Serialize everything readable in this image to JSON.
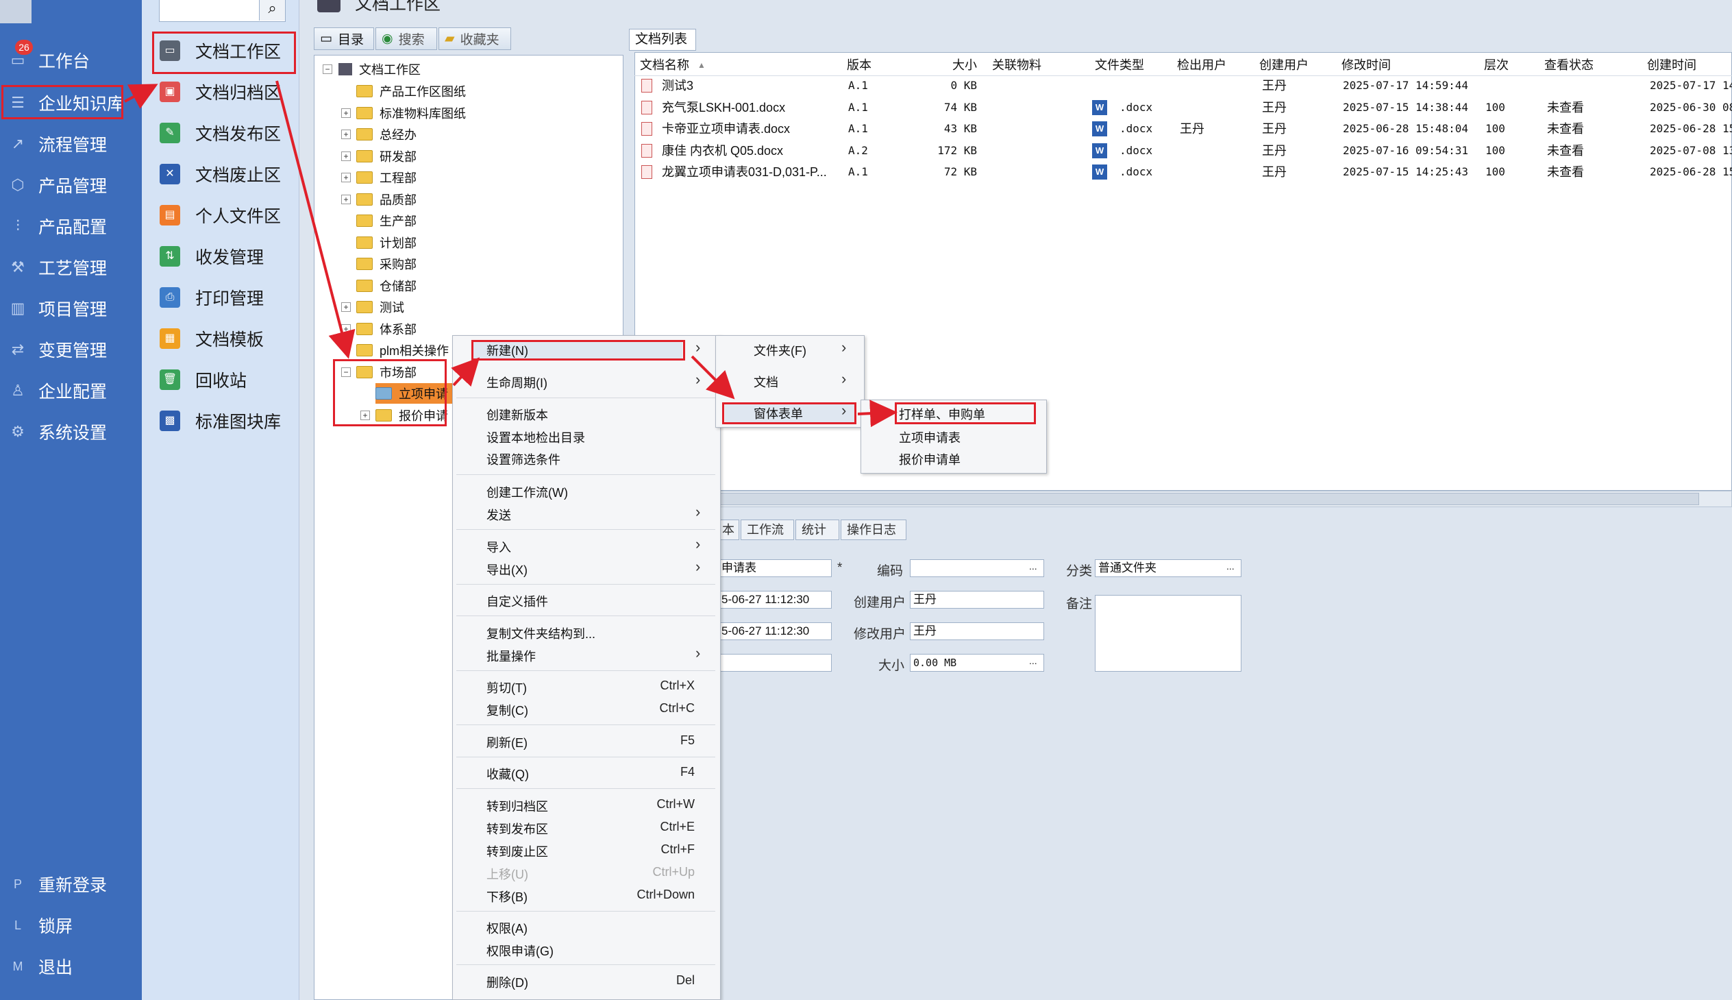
{
  "sidebar": {
    "badge": "26",
    "items": [
      {
        "label": "工作台",
        "icon": "monitor-icon"
      },
      {
        "label": "企业知识库",
        "icon": "library-icon"
      },
      {
        "label": "流程管理",
        "icon": "flow-icon"
      },
      {
        "label": "产品管理",
        "icon": "cube-icon"
      },
      {
        "label": "产品配置",
        "icon": "sliders-icon"
      },
      {
        "label": "工艺管理",
        "icon": "wrench-icon"
      },
      {
        "label": "项目管理",
        "icon": "chart-icon"
      },
      {
        "label": "变更管理",
        "icon": "swap-icon"
      },
      {
        "label": "企业配置",
        "icon": "users-icon"
      },
      {
        "label": "系统设置",
        "icon": "gear-icon"
      }
    ],
    "bottom": [
      {
        "key": "P",
        "label": "重新登录"
      },
      {
        "key": "L",
        "label": "锁屏"
      },
      {
        "key": "M",
        "label": "退出"
      }
    ]
  },
  "submenu": {
    "items": [
      {
        "label": "文档工作区",
        "color": "#5a6472"
      },
      {
        "label": "文档归档区",
        "color": "#e05050"
      },
      {
        "label": "文档发布区",
        "color": "#3aa35a"
      },
      {
        "label": "文档废止区",
        "color": "#2f5fb0"
      },
      {
        "label": "个人文件区",
        "color": "#f07a2a"
      },
      {
        "label": "收发管理",
        "color": "#3aa35a"
      },
      {
        "label": "打印管理",
        "color": "#3d7cc9"
      },
      {
        "label": "文档模板",
        "color": "#f0a020"
      },
      {
        "label": "回收站",
        "color": "#3aa35a"
      },
      {
        "label": "标准图块库",
        "color": "#2f5fb0"
      }
    ]
  },
  "main": {
    "title": "文档工作区",
    "left_tabs": [
      "目录",
      "搜索",
      "收藏夹"
    ],
    "tree": {
      "root": "文档工作区",
      "nodes": [
        "产品工作区图纸",
        "标准物料库图纸",
        "总经办",
        "研发部",
        "工程部",
        "品质部",
        "生产部",
        "计划部",
        "采购部",
        "仓储部",
        "测试",
        "体系部",
        "plm相关操作",
        "市场部"
      ],
      "children": [
        "立项申请",
        "报价申请"
      ]
    },
    "doclist": {
      "tab": "文档列表",
      "columns": [
        "文档名称",
        "版本",
        "大小",
        "关联物料",
        "文件类型",
        "检出用户",
        "创建用户",
        "修改时间",
        "层次",
        "查看状态",
        "创建时间"
      ],
      "rows": [
        {
          "name": "测试3",
          "ver": "A.1",
          "size": "0 KB",
          "material": "",
          "type": "",
          "checkout": "",
          "creator": "王丹",
          "mtime": "2025-07-17 14:59:44",
          "level": "",
          "status": "",
          "ctime": "2025-07-17 14"
        },
        {
          "name": "充气泵LSKH-001.docx",
          "ver": "A.1",
          "size": "74 KB",
          "material": "",
          "type": ".docx",
          "checkout": "",
          "creator": "王丹",
          "mtime": "2025-07-15 14:38:44",
          "level": "100",
          "status": "未查看",
          "ctime": "2025-06-30 08"
        },
        {
          "name": "卡帝亚立项申请表.docx",
          "ver": "A.1",
          "size": "43 KB",
          "material": "",
          "type": ".docx",
          "checkout": "王丹",
          "creator": "王丹",
          "mtime": "2025-06-28 15:48:04",
          "level": "100",
          "status": "未查看",
          "ctime": "2025-06-28 15"
        },
        {
          "name": "康佳 内衣机 Q05.docx",
          "ver": "A.2",
          "size": "172 KB",
          "material": "",
          "type": ".docx",
          "checkout": "",
          "creator": "王丹",
          "mtime": "2025-07-16 09:54:31",
          "level": "100",
          "status": "未查看",
          "ctime": "2025-07-08 13"
        },
        {
          "name": "龙翼立项申请表031-D,031-P...",
          "ver": "A.1",
          "size": "72 KB",
          "material": "",
          "type": ".docx",
          "checkout": "",
          "creator": "王丹",
          "mtime": "2025-07-15 14:25:43",
          "level": "100",
          "status": "未查看",
          "ctime": "2025-06-28 15"
        }
      ]
    },
    "bottom_tabs": [
      "本",
      "工作流",
      "统计",
      "操作日志"
    ],
    "props": {
      "name_value": "申请表",
      "required_mark": "*",
      "ctime_value": "5-06-27 11:12:30",
      "mtime_value": "5-06-27 11:12:30",
      "code_label": "编码",
      "code_value": "",
      "creator_label": "创建用户",
      "creator_value": "王丹",
      "modifier_label": "修改用户",
      "modifier_value": "王丹",
      "size_label": "大小",
      "size_value": "0.00 MB",
      "category_label": "分类",
      "category_value": "普通文件夹",
      "note_label": "备注",
      "dots": "..."
    }
  },
  "context_menu": {
    "items": [
      {
        "label": "新建(N)",
        "shortcut": "",
        "sub": true
      },
      {
        "label": "生命周期(I)",
        "shortcut": "",
        "sub": true
      },
      {
        "label": "创建新版本",
        "shortcut": ""
      },
      {
        "label": "设置本地检出目录",
        "shortcut": ""
      },
      {
        "label": "设置筛选条件",
        "shortcut": ""
      },
      {
        "label": "创建工作流(W)",
        "shortcut": ""
      },
      {
        "label": "发送",
        "shortcut": "",
        "sub": true
      },
      {
        "label": "导入",
        "shortcut": "",
        "sub": true
      },
      {
        "label": "导出(X)",
        "shortcut": "",
        "sub": true
      },
      {
        "label": "自定义插件",
        "shortcut": ""
      },
      {
        "label": "复制文件夹结构到...",
        "shortcut": ""
      },
      {
        "label": "批量操作",
        "shortcut": "",
        "sub": true
      },
      {
        "label": "剪切(T)",
        "shortcut": "Ctrl+X"
      },
      {
        "label": "复制(C)",
        "shortcut": "Ctrl+C"
      },
      {
        "label": "刷新(E)",
        "shortcut": "F5"
      },
      {
        "label": "收藏(Q)",
        "shortcut": "F4"
      },
      {
        "label": "转到归档区",
        "shortcut": "Ctrl+W"
      },
      {
        "label": "转到发布区",
        "shortcut": "Ctrl+E"
      },
      {
        "label": "转到废止区",
        "shortcut": "Ctrl+F"
      },
      {
        "label": "上移(U)",
        "shortcut": "Ctrl+Up"
      },
      {
        "label": "下移(B)",
        "shortcut": "Ctrl+Down"
      },
      {
        "label": "权限(A)",
        "shortcut": ""
      },
      {
        "label": "权限申请(G)",
        "shortcut": ""
      },
      {
        "label": "删除(D)",
        "shortcut": "Del"
      }
    ],
    "submenu_new": [
      "文件夹(F)",
      "文档",
      "窗体表单"
    ],
    "submenu_forms": [
      "打样单、申购单",
      "立项申请表",
      "报价申请单"
    ]
  },
  "colors": {
    "annotation": "#e0202a",
    "sidebar": "#3d6dbb",
    "submenu": "#d5e3f5"
  }
}
